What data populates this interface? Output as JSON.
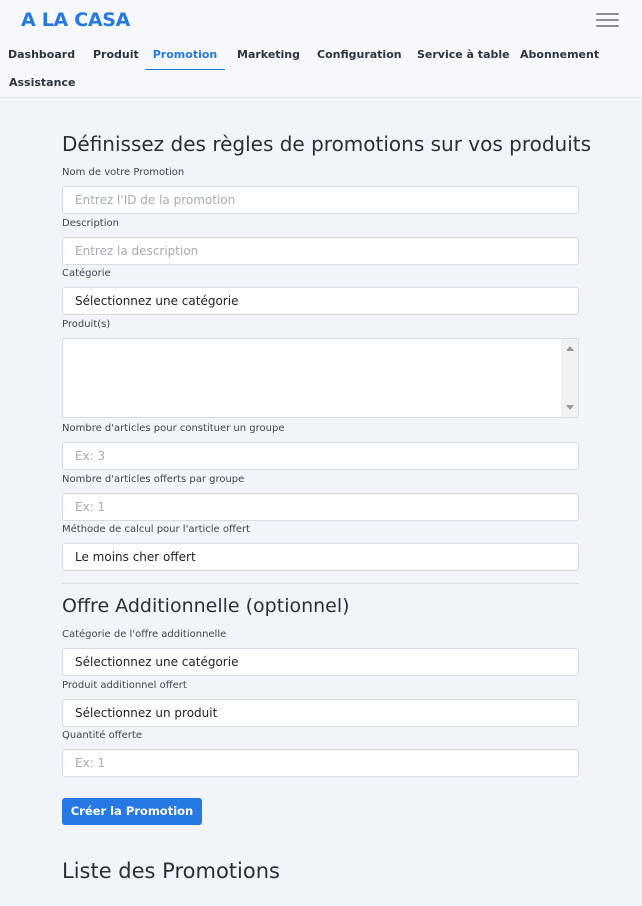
{
  "brand": "A LA CASA",
  "nav": {
    "items": [
      {
        "label": "Dashboard"
      },
      {
        "label": "Produit"
      },
      {
        "label": "Promotion"
      },
      {
        "label": "Marketing"
      },
      {
        "label": "Configuration"
      },
      {
        "label": "Service à table"
      },
      {
        "label": "Abonnement"
      },
      {
        "label": "Assistance"
      }
    ],
    "active": "Promotion"
  },
  "form": {
    "title": "Définissez des règles de promotions sur vos produits",
    "name": {
      "label": "Nom de votre Promotion",
      "placeholder": "Entrez l'ID de la promotion"
    },
    "description": {
      "label": "Description",
      "placeholder": "Entrez la description"
    },
    "category": {
      "label": "Catégorie",
      "value": "Sélectionnez une catégorie"
    },
    "products": {
      "label": "Produit(s)"
    },
    "group_size": {
      "label": "Nombre d'articles pour constituer un groupe",
      "placeholder": "Ex: 3"
    },
    "free_per_group": {
      "label": "Nombre d'articles offerts par groupe",
      "placeholder": "Ex: 1"
    },
    "calc_method": {
      "label": "Méthode de calcul pour l'article offert",
      "value": "Le moins cher offert"
    }
  },
  "additional": {
    "title": "Offre Additionnelle (optionnel)",
    "category": {
      "label": "Catégorie de l'offre additionnelle",
      "value": "Sélectionnez une catégorie"
    },
    "product": {
      "label": "Produit additionnel offert",
      "value": "Sélectionnez un produit"
    },
    "quantity": {
      "label": "Quantité offerte",
      "placeholder": "Ex: 1"
    }
  },
  "submit_label": "Créer la Promotion",
  "list_title": "Liste des Promotions",
  "colors": {
    "accent": "#2678e3",
    "background": "#f1f5fa"
  }
}
